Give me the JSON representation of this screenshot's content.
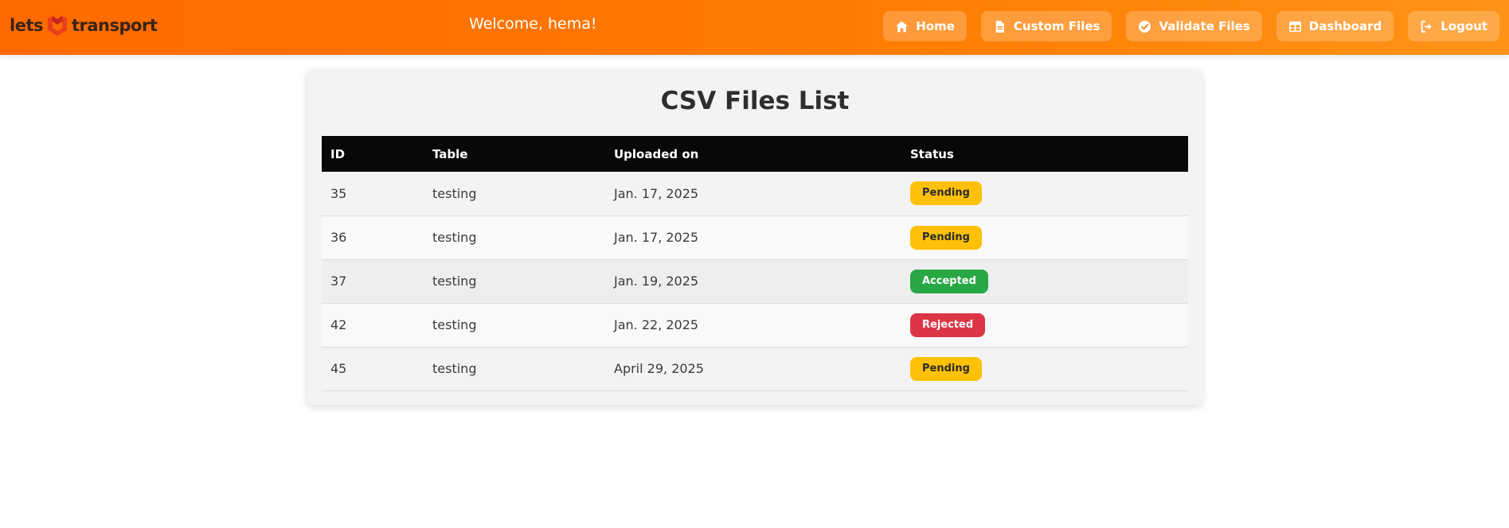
{
  "header": {
    "logo": {
      "left": "lets",
      "right": "transport"
    },
    "welcome": "Welcome, hema!",
    "nav": [
      {
        "label": "Home",
        "icon": "home-icon"
      },
      {
        "label": "Custom Files",
        "icon": "file-icon"
      },
      {
        "label": "Validate Files",
        "icon": "check-circle-icon"
      },
      {
        "label": "Dashboard",
        "icon": "table-icon"
      },
      {
        "label": "Logout",
        "icon": "logout-icon"
      }
    ]
  },
  "main": {
    "title": "CSV Files List",
    "columns": [
      "ID",
      "Table",
      "Uploaded on",
      "Status"
    ],
    "rows": [
      {
        "id": "35",
        "table": "testing",
        "uploaded": "Jan. 17, 2025",
        "status": "Pending",
        "status_kind": "pending"
      },
      {
        "id": "36",
        "table": "testing",
        "uploaded": "Jan. 17, 2025",
        "status": "Pending",
        "status_kind": "pending"
      },
      {
        "id": "37",
        "table": "testing",
        "uploaded": "Jan. 19, 2025",
        "status": "Accepted",
        "status_kind": "accepted"
      },
      {
        "id": "42",
        "table": "testing",
        "uploaded": "Jan. 22, 2025",
        "status": "Rejected",
        "status_kind": "rejected"
      },
      {
        "id": "45",
        "table": "testing",
        "uploaded": "April 29, 2025",
        "status": "Pending",
        "status_kind": "pending"
      }
    ]
  },
  "colors": {
    "header_start": "#ff6a00",
    "header_end": "#ff9418",
    "pending": "#ffc107",
    "accepted": "#28a745",
    "rejected": "#dc3545",
    "table_header": "#080808"
  }
}
